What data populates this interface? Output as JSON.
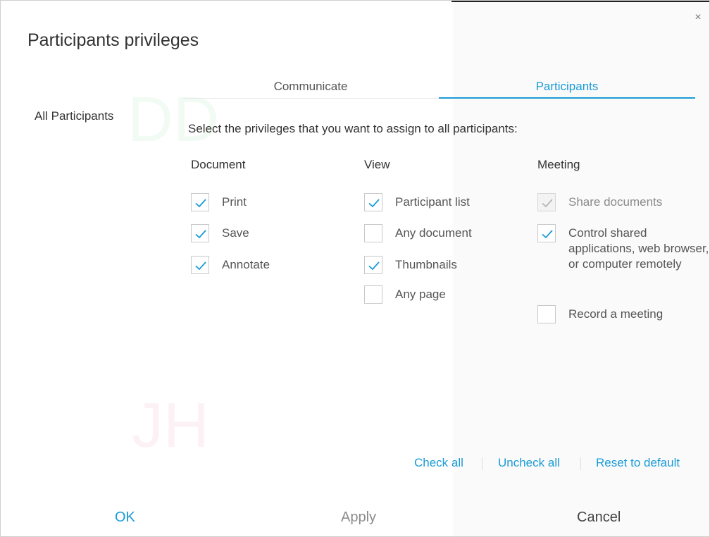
{
  "dialog": {
    "title": "Participants privileges",
    "close_glyph": "×"
  },
  "tabs": [
    {
      "label": "Communicate",
      "active": false
    },
    {
      "label": "Participants",
      "active": true
    }
  ],
  "sidebar": {
    "items": [
      {
        "label": "All Participants",
        "selected": true
      }
    ]
  },
  "instruction": "Select the privileges that you want to assign to all participants:",
  "columns": [
    {
      "heading": "Document",
      "options": [
        {
          "label": "Print",
          "checked": true,
          "disabled": false
        },
        {
          "label": "Save",
          "checked": true,
          "disabled": false
        },
        {
          "label": "Annotate",
          "checked": true,
          "disabled": false
        }
      ]
    },
    {
      "heading": "View",
      "options": [
        {
          "label": "Participant list",
          "checked": true,
          "disabled": false
        },
        {
          "label": "Any document",
          "checked": false,
          "disabled": false
        },
        {
          "label": "Thumbnails",
          "checked": true,
          "disabled": false
        },
        {
          "label": "Any page",
          "checked": false,
          "disabled": false
        }
      ]
    },
    {
      "heading": "Meeting",
      "options": [
        {
          "label": "Share documents",
          "checked": true,
          "disabled": true
        },
        {
          "label": "Control shared applications, web browser, or computer remotely",
          "checked": true,
          "disabled": false
        },
        {
          "label": "Record a meeting",
          "checked": false,
          "disabled": false
        }
      ]
    }
  ],
  "links": {
    "check_all": "Check all",
    "uncheck_all": "Uncheck all",
    "reset_default": "Reset to default"
  },
  "buttons": {
    "ok": "OK",
    "apply": "Apply",
    "cancel": "Cancel"
  },
  "watermarks": [
    "DD",
    "JH"
  ],
  "colors": {
    "accent": "#1a9bd7",
    "check_disabled": "#b5b5b5"
  }
}
